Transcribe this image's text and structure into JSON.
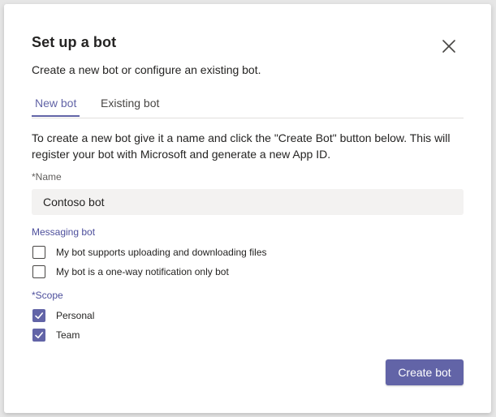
{
  "dialog": {
    "title": "Set up a bot",
    "subtitle": "Create a new bot or configure an existing bot.",
    "close_icon": "close-icon"
  },
  "tabs": [
    {
      "label": "New bot",
      "active": true
    },
    {
      "label": "Existing bot",
      "active": false
    }
  ],
  "description": "To create a new bot give it a name and click the \"Create Bot\" button below. This will register your bot with Microsoft and generate a new App ID.",
  "name_field": {
    "label": "*Name",
    "value": "Contoso bot"
  },
  "messaging": {
    "label": "Messaging bot",
    "options": [
      {
        "label": "My bot supports uploading and downloading files",
        "checked": false
      },
      {
        "label": "My bot is a one-way notification only bot",
        "checked": false
      }
    ]
  },
  "scope": {
    "label": "*Scope",
    "options": [
      {
        "label": "Personal",
        "checked": true
      },
      {
        "label": "Team",
        "checked": true
      }
    ]
  },
  "actions": {
    "create_label": "Create bot"
  },
  "colors": {
    "accent": "#6264a7",
    "input_bg": "#f3f2f1"
  }
}
